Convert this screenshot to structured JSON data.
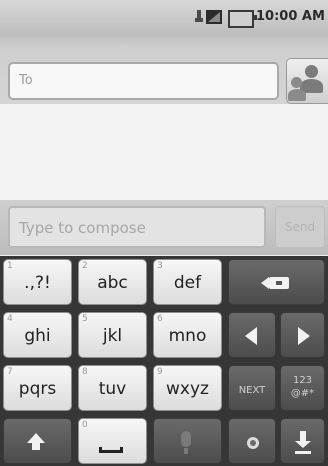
{
  "status_bar": {
    "time": "10:00 AM",
    "icons": [
      "usb-icon",
      "signal-icon",
      "battery-icon"
    ]
  },
  "recipient": {
    "to_placeholder": "To",
    "contacts_icon": "contacts-icon"
  },
  "compose": {
    "placeholder": "Type to compose",
    "send_label": "Send"
  },
  "keyboard": {
    "rows": [
      [
        {
          "sub": "1",
          "label": ".,?!"
        },
        {
          "sub": "2",
          "label": "abc"
        },
        {
          "sub": "3",
          "label": "def"
        },
        {
          "icon": "backspace-icon"
        }
      ],
      [
        {
          "sub": "4",
          "label": "ghi"
        },
        {
          "sub": "5",
          "label": "jkl"
        },
        {
          "sub": "6",
          "label": "mno"
        },
        {
          "icon": "arrow-left-icon"
        },
        {
          "icon": "arrow-right-icon"
        }
      ],
      [
        {
          "sub": "7",
          "label": "pqrs"
        },
        {
          "sub": "8",
          "label": "tuv"
        },
        {
          "sub": "9",
          "label": "wxyz"
        },
        {
          "label": "NEXT"
        },
        {
          "label": "123\n@#*"
        }
      ],
      [
        {
          "icon": "shift-icon"
        },
        {
          "sub": "0",
          "icon": "space-icon"
        },
        {
          "icon": "microphone-icon"
        },
        {
          "icon": "settings-icon"
        },
        {
          "icon": "hide-keyboard-icon"
        }
      ]
    ]
  },
  "colors": {
    "keyboard_bg": "#363636",
    "light_key": "#e9e9e9",
    "dark_key": "#5a5a5a",
    "status_bar": "#cccccc"
  }
}
